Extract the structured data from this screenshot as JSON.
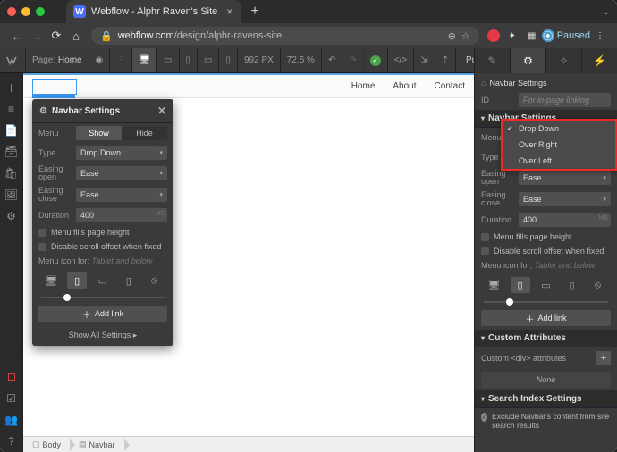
{
  "browser": {
    "tab_title": "Webflow - Alphr Raven's Site",
    "url_host": "webflow.com",
    "url_path": "/design/alphr-ravens-site",
    "favicon_letter": "W",
    "paused": "Paused"
  },
  "topbar": {
    "page_label": "Page:",
    "page_name": "Home",
    "width_px": "992 PX",
    "zoom": "72.5 %",
    "publish": "Publish"
  },
  "canvas_nav": {
    "links": [
      "Home",
      "About",
      "Contact"
    ]
  },
  "breadcrumb": {
    "body": "Body",
    "navbar": "Navbar"
  },
  "panel": {
    "title": "Navbar Settings",
    "menu_label": "Menu",
    "menu_show": "Show",
    "menu_hide": "Hide",
    "type_label": "Type",
    "type_value": "Drop Down",
    "easing_open_label": "Easing open",
    "easing_open_value": "Ease",
    "easing_close_label": "Easing close",
    "easing_close_value": "Ease",
    "duration_label": "Duration",
    "duration_value": "400",
    "ms": "MS",
    "check_fills": "Menu fills page height",
    "check_scroll": "Disable scroll offset when fixed",
    "menu_icon_label": "Menu icon for:",
    "menu_icon_hint": "Tablet and below",
    "add_link": "Add link",
    "show_all": "Show All Settings  ▸"
  },
  "right": {
    "crumb_title": "Navbar Settings",
    "id_label": "ID",
    "id_placeholder": "For in-page linking",
    "section_navbar": "Navbar Settings",
    "section_custom": "Custom Attributes",
    "custom_sub": "Custom <div> attributes",
    "none": "None",
    "section_search": "Search Index Settings",
    "exclude": "Exclude Navbar's content from site search results"
  },
  "type_dropdown": {
    "items": [
      "Drop Down",
      "Over Right",
      "Over Left"
    ],
    "selected": 0
  }
}
